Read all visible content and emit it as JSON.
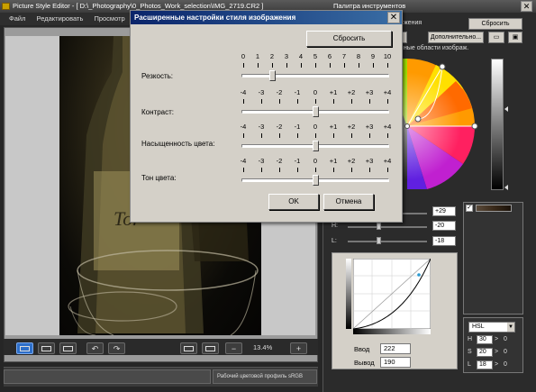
{
  "main_window": {
    "title": "Picture Style Editor - [ D:\\_Photography\\0_Photos_Work_selection\\IMG_2719.CR2 ]",
    "menu": [
      "Файл",
      "Редактировать",
      "Просмотр"
    ],
    "zoom": "13.4%",
    "status_profile": "Рабочий цветовой профиль sRGB"
  },
  "palette": {
    "title": "Палитра инструментов",
    "top_label": "жения",
    "reset_label": "Сбросить",
    "advanced_label": "Дополнительно...",
    "hint": "ные области изображ.",
    "rows": [
      {
        "label": "H:",
        "value": "+29"
      },
      {
        "label": "S:",
        "value": "-20"
      },
      {
        "label": "L:",
        "value": "-18"
      }
    ],
    "curve": {
      "input_label": "Ввод",
      "input_value": "222",
      "output_label": "Вывод",
      "output_value": "190"
    },
    "hsl": {
      "mode": "HSL",
      "rows": [
        {
          "label": "H",
          "value": "30",
          "suffix": "0"
        },
        {
          "label": "S",
          "value": "20",
          "suffix": "0"
        },
        {
          "label": "L",
          "value": "18",
          "suffix": "0"
        }
      ]
    }
  },
  "dialog": {
    "title": "Расширенные настройки стиля изображения",
    "reset_label": "Сбросить",
    "ok_label": "OK",
    "cancel_label": "Отмена",
    "sliders": [
      {
        "label": "Резкость:",
        "scale": [
          "0",
          "1",
          "2",
          "3",
          "4",
          "5",
          "6",
          "7",
          "8",
          "9",
          "10"
        ],
        "value": 2
      },
      {
        "label": "Контраст:",
        "scale": [
          "-4",
          "-3",
          "-2",
          "-1",
          "0",
          "+1",
          "+2",
          "+3",
          "+4"
        ],
        "value": 0
      },
      {
        "label": "Насыщенность цвета:",
        "scale": [
          "-4",
          "-3",
          "-2",
          "-1",
          "0",
          "+1",
          "+2",
          "+3",
          "+4"
        ],
        "value": 0
      },
      {
        "label": "Тон цвета:",
        "scale": [
          "-4",
          "-3",
          "-2",
          "-1",
          "0",
          "+1",
          "+2",
          "+3",
          "+4"
        ],
        "value": 0
      }
    ]
  },
  "colors": {
    "dialog_bg": "#d4d0c8",
    "title_active": "#0a246a",
    "toolbar_active": "#2e6fc9"
  }
}
